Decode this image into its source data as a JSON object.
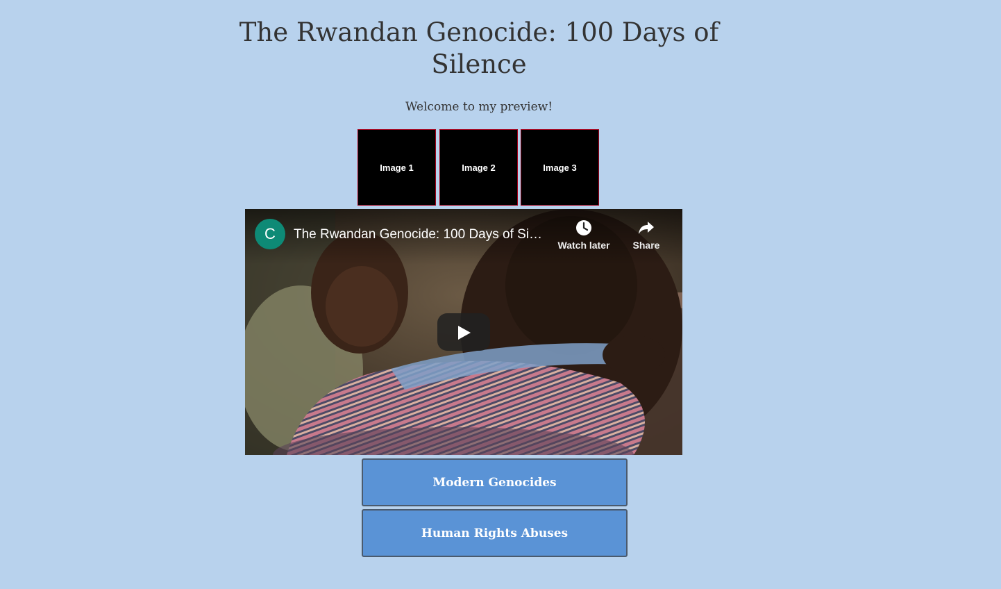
{
  "page": {
    "title": "The Rwandan Genocide: 100 Days of Silence",
    "welcome": "Welcome to my preview!",
    "background_color": "#b8d2ed"
  },
  "thumbnails": [
    {
      "label": "Image 1"
    },
    {
      "label": "Image 2"
    },
    {
      "label": "Image 3"
    }
  ],
  "video": {
    "channel_initial": "C",
    "title": "The Rwandan Genocide: 100 Days of Si…",
    "watch_later_label": "Watch later",
    "watch_later_icon": "clock-icon",
    "share_label": "Share",
    "share_icon": "share-arrow-icon",
    "play_icon": "play-icon",
    "channel_color": "#0e8a76"
  },
  "nav_buttons": [
    {
      "label": "Modern Genocides"
    },
    {
      "label": "Human Rights Abuses"
    }
  ],
  "colors": {
    "button_fill": "#5a93d6",
    "thumb_border": "#a3001a"
  }
}
